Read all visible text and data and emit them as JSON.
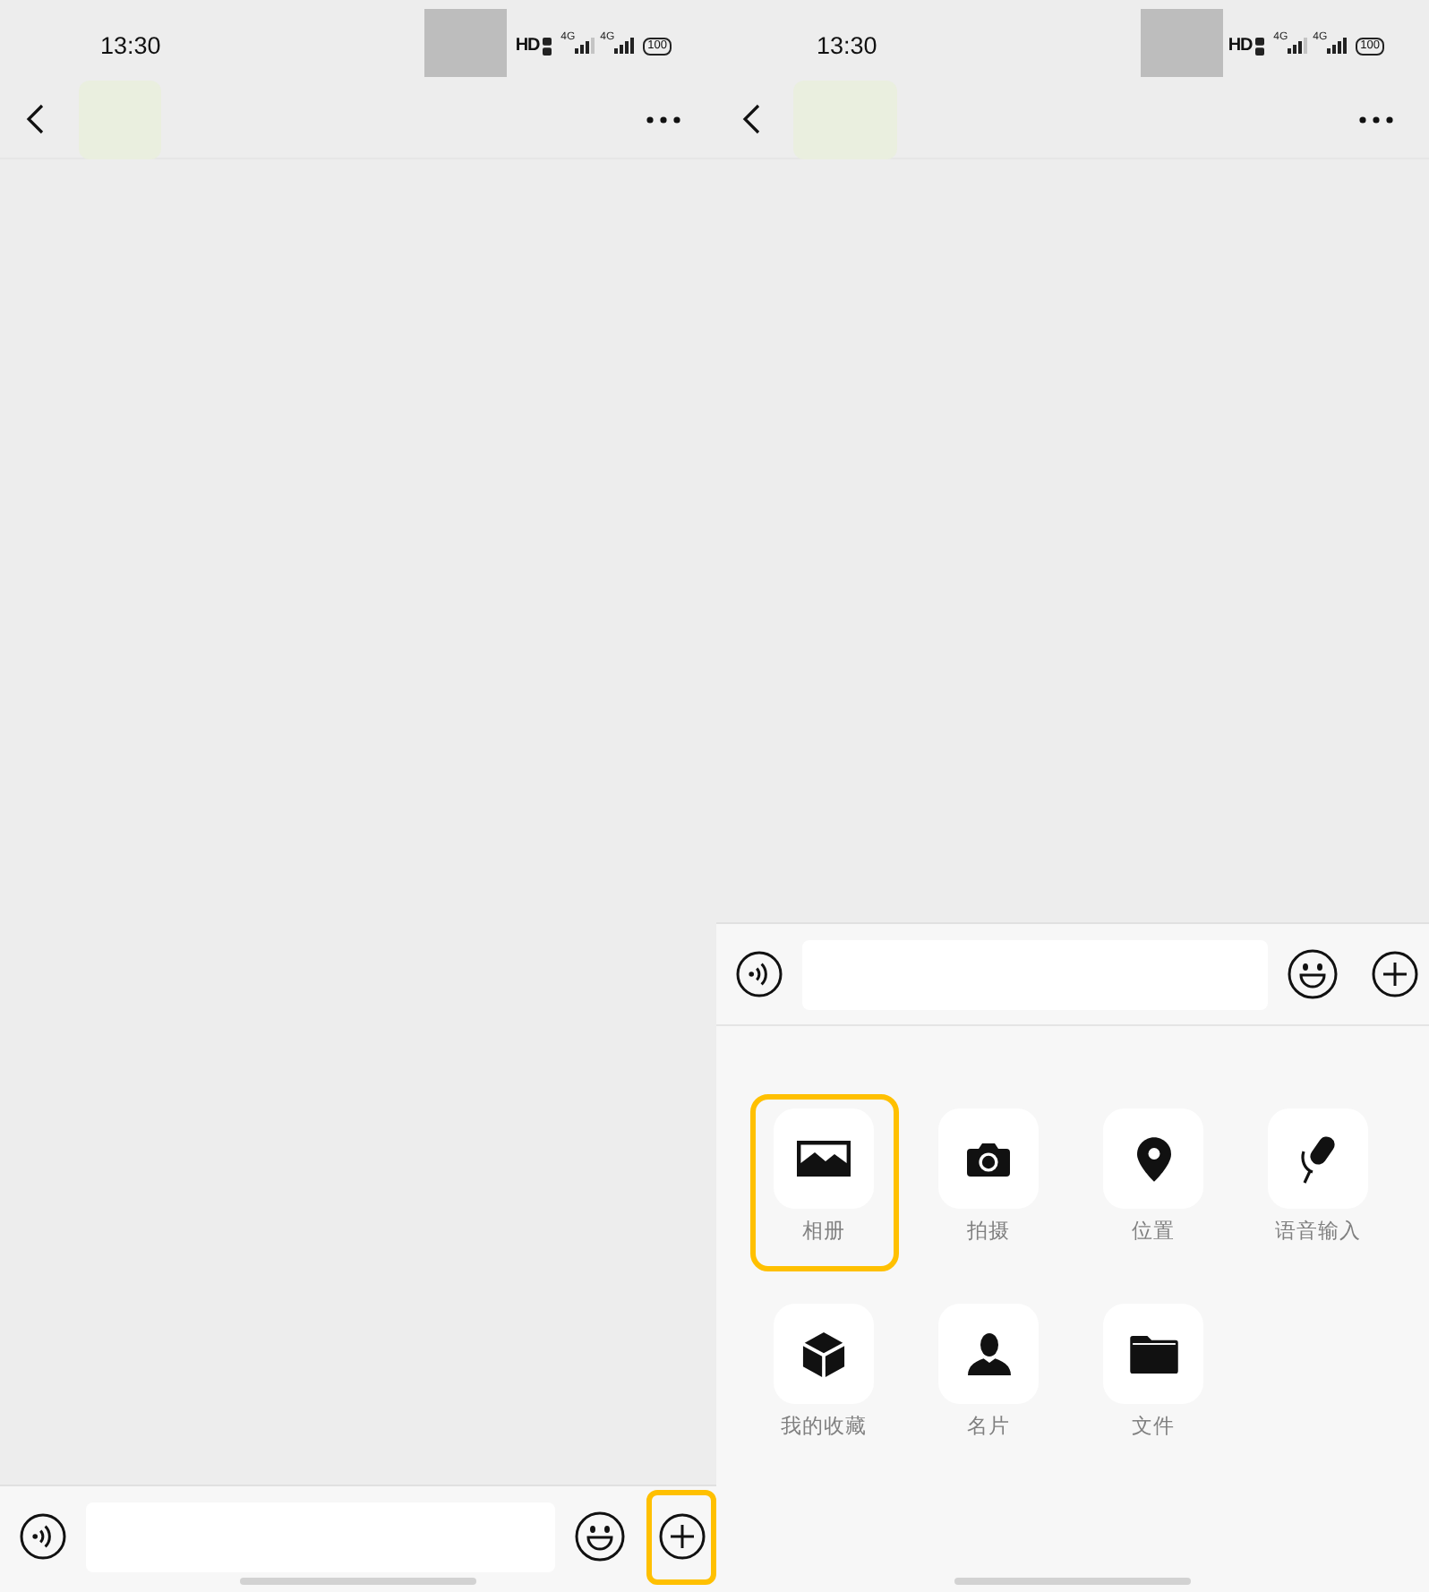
{
  "screens": [
    {
      "status_bar": {
        "time": "13:30",
        "hd": "HD",
        "networks": [
          "4G",
          "4G"
        ],
        "battery": "100"
      },
      "input_bar": {
        "plus_highlighted": true
      }
    },
    {
      "status_bar": {
        "time": "13:30",
        "hd": "HD",
        "networks": [
          "4G",
          "4G"
        ],
        "battery": "100"
      },
      "input_bar": {
        "plus_highlighted": false
      },
      "panel": {
        "items": [
          {
            "kind": "album",
            "label": "相册",
            "highlighted": true
          },
          {
            "kind": "camera",
            "label": "拍摄",
            "highlighted": false
          },
          {
            "kind": "location",
            "label": "位置",
            "highlighted": false
          },
          {
            "kind": "voice",
            "label": "语音输入",
            "highlighted": false
          },
          {
            "kind": "favorites",
            "label": "我的收藏",
            "highlighted": false
          },
          {
            "kind": "card",
            "label": "名片",
            "highlighted": false
          },
          {
            "kind": "file",
            "label": "文件",
            "highlighted": false
          }
        ]
      }
    }
  ]
}
